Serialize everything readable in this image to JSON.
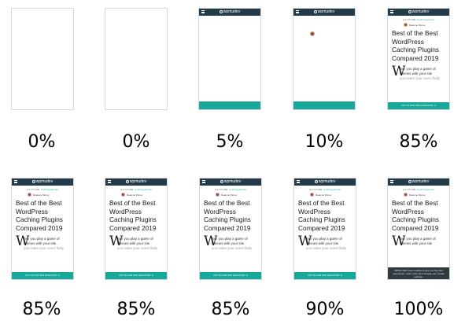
{
  "site": {
    "brand": "wpmudev",
    "author": "Raelene Morey",
    "meta_views": "● 4,777,000",
    "meta_comments": "⊙ 22 Comments"
  },
  "article": {
    "title": "Best of the Best WordPress Caching Plugins Compared 2019",
    "dropcap": "W",
    "intro_line1": "hen you play a game of",
    "intro_line2": "themes with your site",
    "intro_faded": "you make your users flatly",
    "cta": "OPT IN FOR 50% DISCOUNT ➜",
    "cookie_notice": "WPMU DEV uses cookies to give you the best experience. Learn more and manage your cookie settings."
  },
  "frames": [
    {
      "label": "0%"
    },
    {
      "label": "0%"
    },
    {
      "label": "5%"
    },
    {
      "label": "10%"
    },
    {
      "label": "85%"
    },
    {
      "label": "85%"
    },
    {
      "label": "85%"
    },
    {
      "label": "85%"
    },
    {
      "label": "90%"
    },
    {
      "label": "100%"
    }
  ],
  "colors": {
    "header": "#243b4a",
    "accent": "#16a99b",
    "cookie_bar": "#2f3a3f"
  }
}
